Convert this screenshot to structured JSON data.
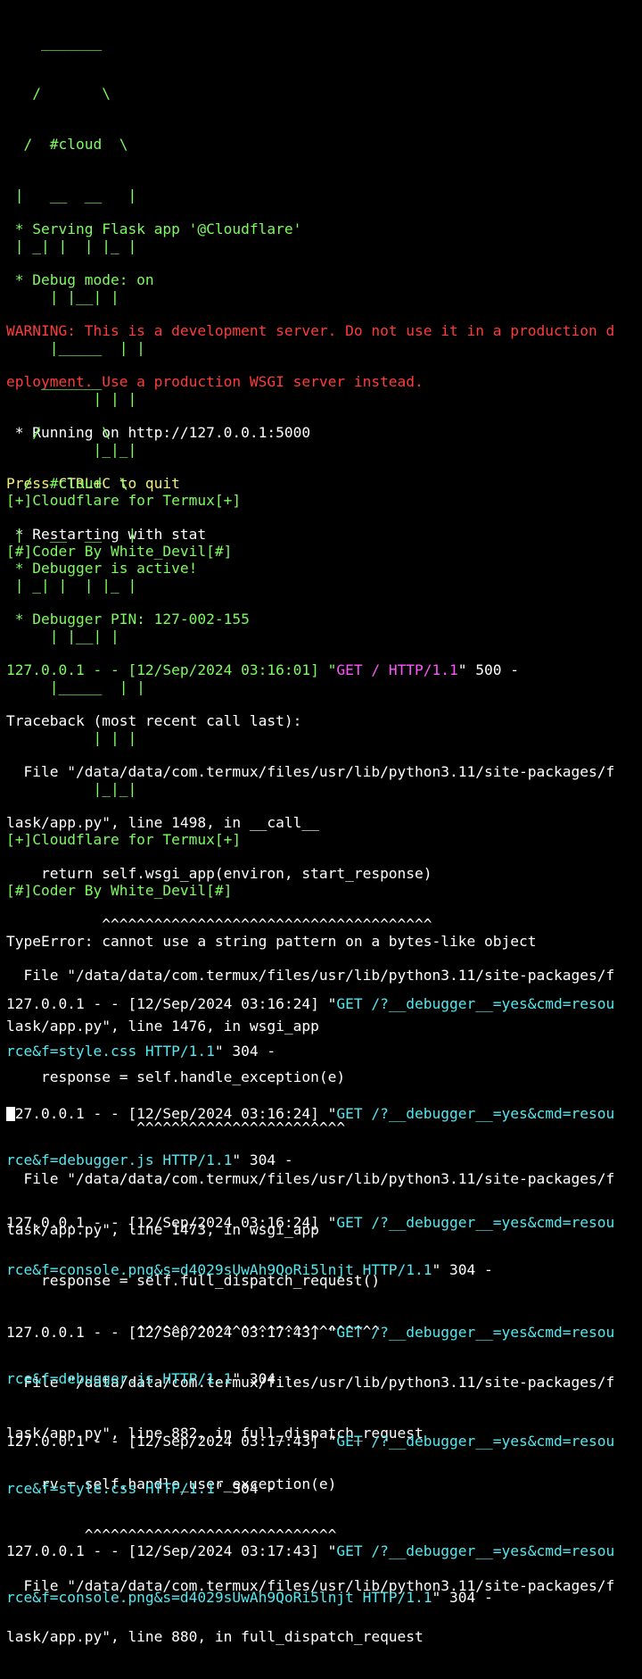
{
  "banner1": {
    "art": [
      "    _______",
      "   /       \\",
      "  /  #cloud  \\",
      " |   __  __   |",
      " | _| |  | |_ |",
      "     | |__| |",
      "     |_____  | |",
      "          | | |",
      "          |_|_|"
    ],
    "credit1": "[+]Cloudflare for Termux[+]",
    "credit2": "[#]Coder By White_Devil[#]"
  },
  "serving": " * Serving Flask app '@Cloudflare'",
  "debug_mode": " * Debug mode: on",
  "warning_line1": "WARNING: This is a development server. Do not use it in a production d",
  "warning_line2": "eployment. Use a production WSGI server instead.",
  "running": " * Running on http://127.0.0.1:5000",
  "quit_hint": "Press CTRL+C to quit",
  "restarting": " * Restarting with stat",
  "banner2": {
    "art": [
      "    _______",
      "   /       \\",
      "  /  #cloud  \\",
      " |   __  __   |",
      " | _| |  | |_ |",
      "     | |__| |",
      "     |_____  | |",
      "          | | |",
      "          |_|_|"
    ],
    "credit1": "[+]Cloudflare for Termux[+]",
    "credit2": "[#]Coder By White_Devil[#]"
  },
  "debugger_active": " * Debugger is active!",
  "debugger_pin": " * Debugger PIN: 127-002-155",
  "request_line": {
    "prefix": "127.0.0.1 - - [12/Sep/2024 03:16:01] \"",
    "request": "GET / HTTP/1.1",
    "suffix": "\" 500 -"
  },
  "traceback": [
    "Traceback (most recent call last):",
    "  File \"/data/data/com.termux/files/usr/lib/python3.11/site-packages/f",
    "lask/app.py\", line 1498, in __call__",
    "    return self.wsgi_app(environ, start_response)",
    "           ^^^^^^^^^^^^^^^^^^^^^^^^^^^^^^^^^^^^^^",
    "  File \"/data/data/com.termux/files/usr/lib/python3.11/site-packages/f",
    "lask/app.py\", line 1476, in wsgi_app",
    "    response = self.handle_exception(e)",
    "               ^^^^^^^^^^^^^^^^^^^^^^^^",
    "  File \"/data/data/com.termux/files/usr/lib/python3.11/site-packages/f",
    "lask/app.py\", line 1473, in wsgi_app",
    "    response = self.full_dispatch_request()",
    "               ^^^^^^^^^^^^^^^^^^^^^^^^^^^^",
    "  File \"/data/data/com.termux/files/usr/lib/python3.11/site-packages/f",
    "lask/app.py\", line 882, in full_dispatch_request",
    "    rv = self.handle_user_exception(e)",
    "         ^^^^^^^^^^^^^^^^^^^^^^^^^^^^^",
    "  File \"/data/data/com.termux/files/usr/lib/python3.11/site-packages/f",
    "lask/app.py\", line 880, in full_dispatch_request"
  ],
  "type_error": "TypeError: cannot use a string pattern on a bytes-like object",
  "access_log": [
    {
      "prefix": "127.0.0.1 - - [12/Sep/2024 03:16:24] \"",
      "req1": "GET /?__debugger__=yes&cmd=resou",
      "req2": "rce&f=style.css HTTP/1.1",
      "suffix": "\" 304 -"
    },
    {
      "prefix": "127.0.0.1 - - [12/Sep/2024 03:16:24] \"",
      "req1": "GET /?__debugger__=yes&cmd=resou",
      "req2": "rce&f=debugger.js HTTP/1.1",
      "suffix": "\" 304 -"
    },
    {
      "prefix": "127.0.0.1 - - [12/Sep/2024 03:16:24] \"",
      "req1": "GET /?__debugger__=yes&cmd=resou",
      "req2": "rce&f=console.png&s=d4029sUwAh9QoRi5lnjt HTTP/1.1",
      "suffix": "\" 304 -"
    },
    {
      "prefix": "127.0.0.1 - - [12/Sep/2024 03:17:43] \"",
      "req1": "GET /?__debugger__=yes&cmd=resou",
      "req2": "rce&f=debugger.js HTTP/1.1",
      "suffix": "\" 304 -"
    },
    {
      "prefix": "127.0.0.1 - - [12/Sep/2024 03:17:43] \"",
      "req1": "GET /?__debugger__=yes&cmd=resou",
      "req2": "rce&f=style.css HTTP/1.1",
      "suffix": "\" 304 -"
    },
    {
      "prefix": "127.0.0.1 - - [12/Sep/2024 03:17:43] \"",
      "req1": "GET /?__debugger__=yes&cmd=resou",
      "req2": "rce&f=console.png&s=d4029sUwAh9QoRi5lnjt HTTP/1.1",
      "suffix": "\" 304 -"
    }
  ],
  "colors": {
    "background": "#000000",
    "banner_green": "#7cfc5e",
    "warning_red": "#ff3b3b",
    "hint_yellow": "#f3ef7a",
    "method_magenta": "#ff55ff",
    "request_cyan": "#55e8f0"
  }
}
